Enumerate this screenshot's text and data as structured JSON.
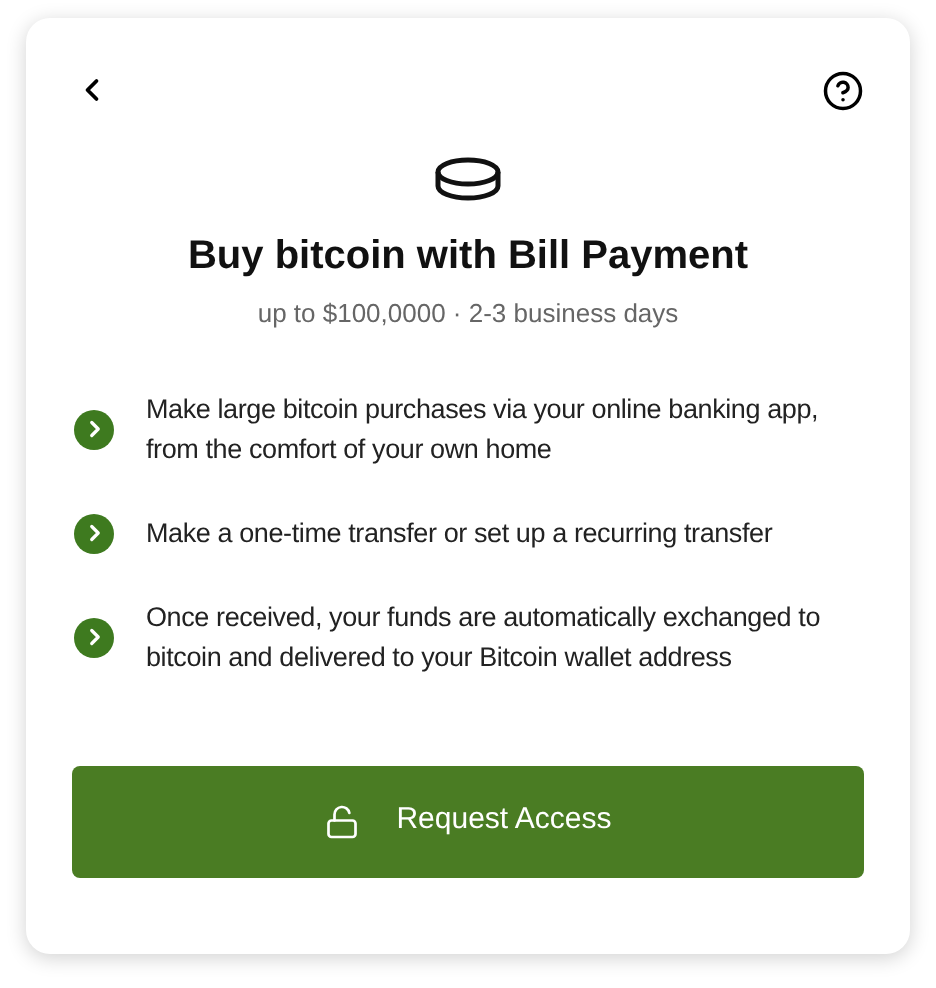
{
  "title": "Buy bitcoin with Bill Payment",
  "subtitle": "up to $100,0000 · 2-3 business days",
  "features": [
    {
      "text": "Make large bitcoin purchases via your online banking app, from the comfort of your own home"
    },
    {
      "text": "Make a one-time transfer or set up a recurring transfer"
    },
    {
      "text": "Once received, your funds are automatically exchanged to bitcoin and delivered to your Bitcoin wallet address"
    }
  ],
  "button": {
    "label": "Request Access"
  }
}
